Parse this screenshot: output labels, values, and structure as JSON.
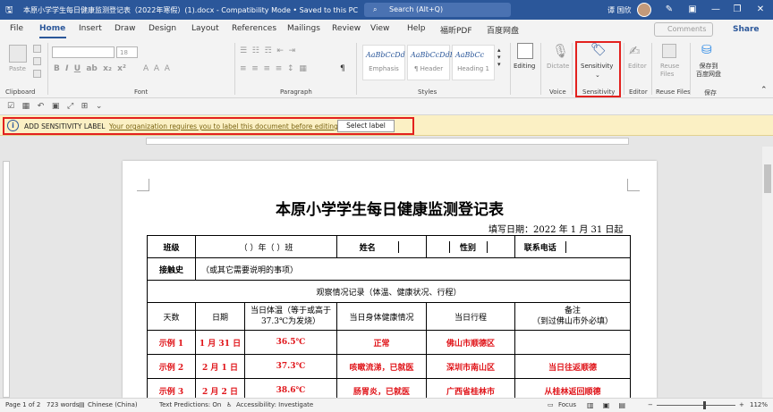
{
  "titlebar": {
    "doc_title": "本原小学学生每日健康监测登记表（2022年寒假）(1).docx  -  Compatibility Mode • Saved to this PC",
    "search_placeholder": "Search (Alt+Q)",
    "user_name": "谭 国欣",
    "accent": "#2b579a"
  },
  "tabs": [
    "File",
    "Home",
    "Insert",
    "Draw",
    "Design",
    "Layout",
    "References",
    "Mailings",
    "Review",
    "View",
    "Help",
    "福昕PDF",
    "百度网盘"
  ],
  "active_tab": "Home",
  "ribbon_actions": {
    "comments": "Comments",
    "share": "Share"
  },
  "ribbon": {
    "paste": "Paste",
    "font_size": "18",
    "styles": [
      {
        "preview": "AaBbCcDd",
        "name": "Emphasis"
      },
      {
        "preview": "AaBbCcDdE",
        "name": "¶ Header"
      },
      {
        "preview": "AaBbCc",
        "name": "Heading 1"
      }
    ],
    "editing": "Editing",
    "dictate": "Dictate",
    "sensitivity": "Sensitivity",
    "editor": "Editor",
    "reuse_files": "Reuse Files",
    "baidu_save": "保存到\n百度网盘",
    "groups": {
      "clipboard": "Clipboard",
      "font": "Font",
      "paragraph": "Paragraph",
      "styles": "Styles",
      "voice": "Voice",
      "sensitivity": "Sensitivity",
      "editor": "Editor",
      "reuse_files": "Reuse Files",
      "save": "保存"
    }
  },
  "infobar": {
    "title": "ADD SENSITIVITY LABEL",
    "message": "Your organization requires you to label this document before editing.",
    "button": "Select label"
  },
  "document": {
    "title": "本原小学学生每日健康监测登记表",
    "fill_date": "填写日期：2022 年 1 月 31 日起",
    "row1": {
      "class_label": "班级",
      "class_value": "（    ）年（    ）班",
      "name_label": "姓名",
      "gender_label": "性别",
      "phone_label": "联系电话"
    },
    "contact_label": "接触史",
    "contact_value": "（或其它需要说明的事项）",
    "observation": "观察情况记录（体温、健康状况、行程）",
    "headers": [
      "天数",
      "日期",
      "当日体温（等于或高于 37.3℃为发烧）",
      "当日身体健康情况",
      "当日行程",
      "备注\n（到过佛山市外必填）"
    ],
    "rows": [
      [
        "示例 1",
        "1 月 31 日",
        "36.5℃",
        "正常",
        "佛山市顺德区",
        ""
      ],
      [
        "示例 2",
        "2 月 1 日",
        "37.3℃",
        "咳嗽流涕，已就医",
        "深圳市南山区",
        "当日往返顺德"
      ],
      [
        "示例 3",
        "2 月 2 日",
        "38.6℃",
        "肠胃炎，已就医",
        "广西省桂林市",
        "从桂林返回顺德"
      ]
    ],
    "example_color": "#e0151a"
  },
  "statusbar": {
    "page": "Page 1 of 2",
    "words": "723 words",
    "language": "Chinese (China)",
    "predictions": "Text Predictions: On",
    "accessibility": "Accessibility: Investigate",
    "focus": "Focus",
    "zoom": "112%"
  }
}
